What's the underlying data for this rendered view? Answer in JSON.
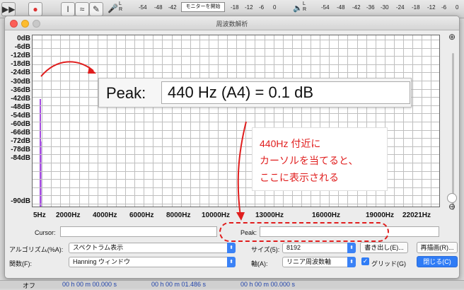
{
  "background": {
    "meter_ticks": [
      "-54",
      "-48",
      "-42",
      "-18",
      "-12",
      "-6",
      "0",
      "-54",
      "-48",
      "-42",
      "-36",
      "-30",
      "-24",
      "-18",
      "-12",
      "-6",
      "0"
    ],
    "monitor_label": "モニターを開始",
    "lr_label_1": "L\nR",
    "lr_label_2": "L\nR",
    "bottom": {
      "rate_label": "オフ",
      "time1": "00 h 00 m 00.000 s",
      "time2": "00 h 00 m 01.486 s",
      "time3": "00 h 00 m 00.000 s"
    }
  },
  "window": {
    "title": "周波数解析",
    "plot": {
      "y_ticks": [
        "0dB",
        "-6dB",
        "-12dB",
        "-18dB",
        "-24dB",
        "-30dB",
        "-36dB",
        "-42dB",
        "-48dB",
        "-54dB",
        "-60dB",
        "-66dB",
        "-72dB",
        "-78dB",
        "-84dB",
        "-90dB"
      ],
      "x_ticks": [
        "5Hz",
        "2000Hz",
        "4000Hz",
        "6000Hz",
        "8000Hz",
        "10000Hz",
        "13000Hz",
        "16000Hz",
        "19000Hz",
        "22021Hz"
      ]
    },
    "cursor_label": "Cursor:",
    "cursor_value": "",
    "peak_label": "Peak:",
    "peak_value": "",
    "algorithm_label": "アルゴリズム(%A):",
    "algorithm_value": "スペクトラム表示",
    "size_label": "サイズ(5):",
    "size_value": "8192",
    "export_button": "書き出し(E)...",
    "replot_button": "再描画(R)...",
    "function_label": "関数(F):",
    "function_value": "Hanning ウィンドウ",
    "axis_label": "軸(A):",
    "axis_value": "リニア周波数軸",
    "grid_label": "グリッド(G)",
    "grid_checked": true,
    "close_button": "閉じる(C)",
    "accent_color": "#2f7cf6"
  },
  "annotation": {
    "callout_label": "Peak:",
    "callout_value": "440 Hz (A4) = 0.1 dB",
    "note_lines": [
      "440Hz 付近に",
      "カーソルを当てると、",
      "ここに表示される"
    ],
    "note_color": "#e01e1e"
  }
}
